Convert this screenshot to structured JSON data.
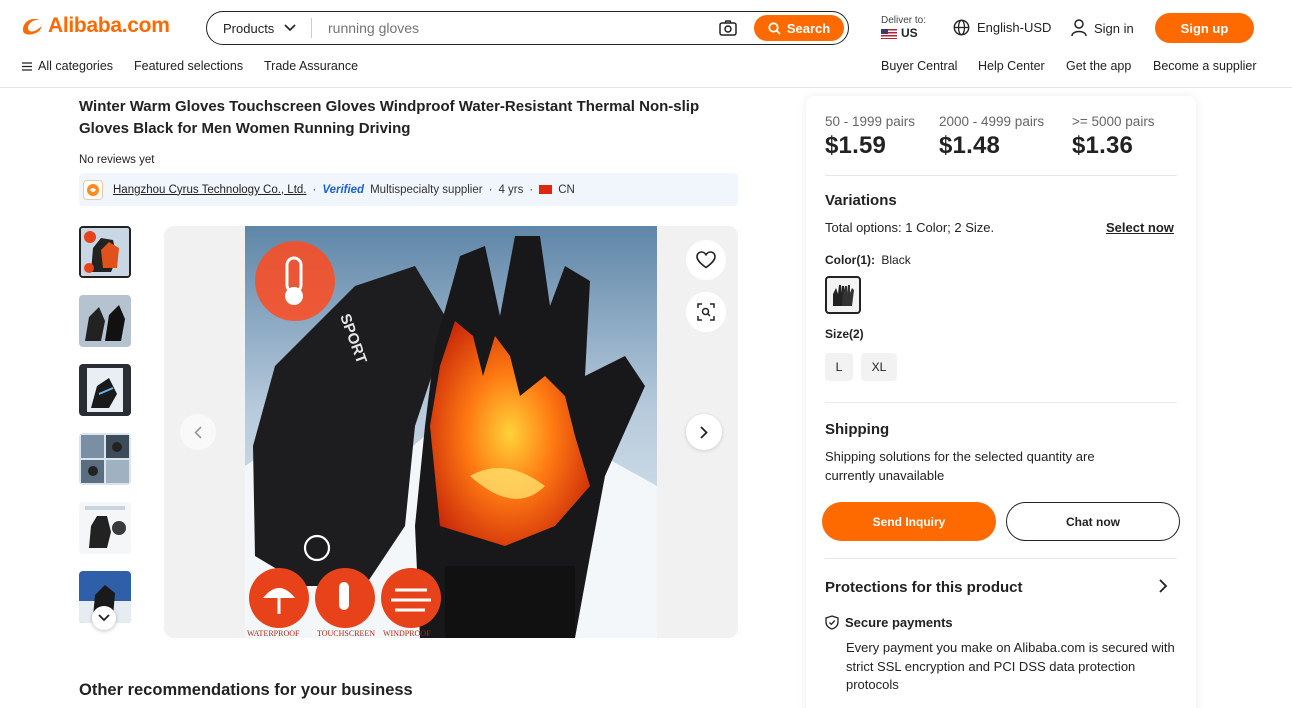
{
  "header": {
    "logo_text": "Alibaba.com",
    "search": {
      "category": "Products",
      "placeholder": "running gloves",
      "button_label": "Search"
    },
    "deliver": {
      "label": "Deliver to:",
      "country": "US"
    },
    "language": "English-USD",
    "sign_in": "Sign in",
    "sign_up": "Sign up"
  },
  "subnav": {
    "left": [
      "All categories",
      "Featured selections",
      "Trade Assurance"
    ],
    "right": [
      "Buyer Central",
      "Help Center",
      "Get the app",
      "Become a supplier"
    ]
  },
  "product": {
    "title": "Winter Warm Gloves Touchscreen Gloves Windproof Water-Resistant Thermal Non-slip Gloves Black for Men Women Running Driving",
    "reviews": "No reviews yet",
    "supplier": {
      "name": "Hangzhou Cyrus Technology Co., Ltd.",
      "verified": "Verified",
      "type": "Multispecialty supplier",
      "years": "4 yrs",
      "country": "CN"
    },
    "image": {
      "brand_text": "SPORT",
      "badges": [
        "WATERPROOF",
        "TOUCHSCREEN",
        "WINDPROOF"
      ]
    }
  },
  "recommendations_title": "Other recommendations for your business",
  "panel": {
    "tiers": [
      {
        "range": "50 - 1999 pairs",
        "price": "$1.59"
      },
      {
        "range": "2000 - 4999 pairs",
        "price": "$1.48"
      },
      {
        "range": ">= 5000 pairs",
        "price": "$1.36"
      }
    ],
    "variations": {
      "heading": "Variations",
      "total_label": "Total options:",
      "total_value": "1 Color; 2 Size.",
      "select_now": "Select now",
      "color_label": "Color(1):",
      "color_value": "Black",
      "size_label": "Size(2)",
      "sizes": [
        "L",
        "XL"
      ]
    },
    "shipping": {
      "heading": "Shipping",
      "text": "Shipping solutions for the selected quantity are currently unavailable"
    },
    "buttons": {
      "inquiry": "Send Inquiry",
      "chat": "Chat now"
    },
    "protections": {
      "heading": "Protections for this product",
      "secure_title": "Secure payments",
      "secure_text": "Every payment you make on Alibaba.com is secured with strict SSL encryption and PCI DSS data protection protocols"
    }
  },
  "colors": {
    "brand_orange": "#ff6a00",
    "verified_blue": "#1f60d6"
  }
}
